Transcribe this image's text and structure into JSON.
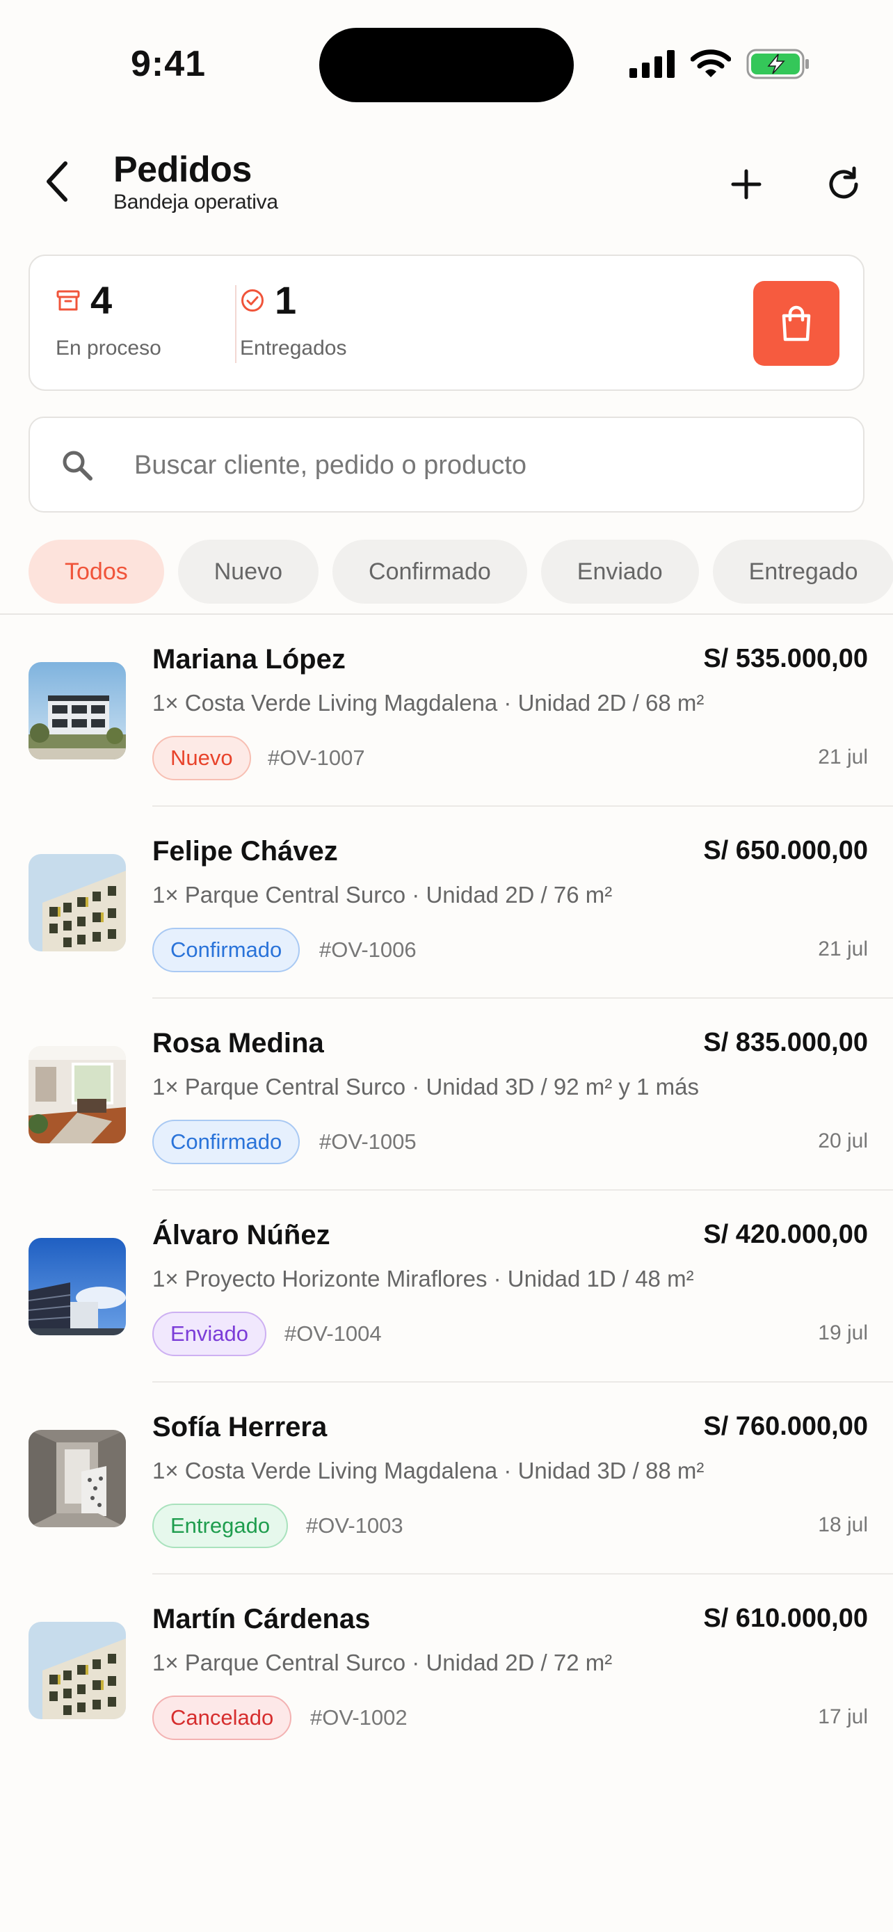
{
  "status_bar": {
    "time": "9:41"
  },
  "header": {
    "title": "Pedidos",
    "subtitle": "Bandeja operativa"
  },
  "stats": {
    "in_process": {
      "count": "4",
      "label": "En proceso"
    },
    "delivered": {
      "count": "1",
      "label": "Entregados"
    }
  },
  "search": {
    "placeholder": "Buscar cliente, pedido o producto",
    "value": ""
  },
  "filters": [
    "Todos",
    "Nuevo",
    "Confirmado",
    "Enviado",
    "Entregado"
  ],
  "active_filter": "Todos",
  "orders": [
    {
      "name": "Mariana López",
      "price": "S/ 535.000,00",
      "desc": "1× Costa Verde Living Magdalena · Unidad 2D / 68 m²",
      "status": "Nuevo",
      "status_key": "nuevo",
      "id": "#OV-1007",
      "date": "21 jul"
    },
    {
      "name": "Felipe Chávez",
      "price": "S/ 650.000,00",
      "desc": "1× Parque Central Surco · Unidad 2D / 76 m²",
      "status": "Confirmado",
      "status_key": "confirmado",
      "id": "#OV-1006",
      "date": "21 jul"
    },
    {
      "name": "Rosa Medina",
      "price": "S/ 835.000,00",
      "desc": "1× Parque Central Surco · Unidad 3D / 92 m² y 1 más",
      "status": "Confirmado",
      "status_key": "confirmado",
      "id": "#OV-1005",
      "date": "20 jul"
    },
    {
      "name": "Álvaro Núñez",
      "price": "S/ 420.000,00",
      "desc": "1× Proyecto Horizonte Miraflores · Unidad 1D / 48 m²",
      "status": "Enviado",
      "status_key": "enviado",
      "id": "#OV-1004",
      "date": "19 jul"
    },
    {
      "name": "Sofía Herrera",
      "price": "S/ 760.000,00",
      "desc": "1× Costa Verde Living Magdalena · Unidad 3D / 88 m²",
      "status": "Entregado",
      "status_key": "entregado",
      "id": "#OV-1003",
      "date": "18 jul"
    },
    {
      "name": "Martín Cárdenas",
      "price": "S/ 610.000,00",
      "desc": "1× Parque Central Surco · Unidad 2D / 72 m²",
      "status": "Cancelado",
      "status_key": "cancelado",
      "id": "#OV-1002",
      "date": "17 jul"
    }
  ],
  "colors": {
    "accent": "#f65b3f",
    "background": "#fdfcfa"
  },
  "icons": [
    "back-icon",
    "plus-icon",
    "refresh-icon",
    "archive-icon",
    "check-circle-icon",
    "shopping-bag-icon",
    "search-icon"
  ]
}
